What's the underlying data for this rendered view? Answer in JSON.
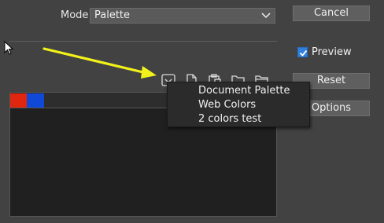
{
  "mode": {
    "label": "Mode",
    "value": "Palette"
  },
  "buttons": {
    "cancel": "Cancel",
    "reset": "Reset",
    "options": "Options"
  },
  "preview": {
    "label": "Preview",
    "checked": true
  },
  "swatches": [
    {
      "color": "#e0260e"
    },
    {
      "color": "#1048d8"
    }
  ],
  "toolbar_icons": [
    "palette-menu-icon",
    "new-document-icon",
    "paste-icon",
    "open-folder-icon",
    "folder-icon"
  ],
  "menu": {
    "items": [
      "Document Palette",
      "Web Colors",
      "2 colors test"
    ]
  },
  "colors": {
    "accent": "#2f7fe0",
    "annotation_arrow": "#f2f21a",
    "background": "#424242"
  }
}
